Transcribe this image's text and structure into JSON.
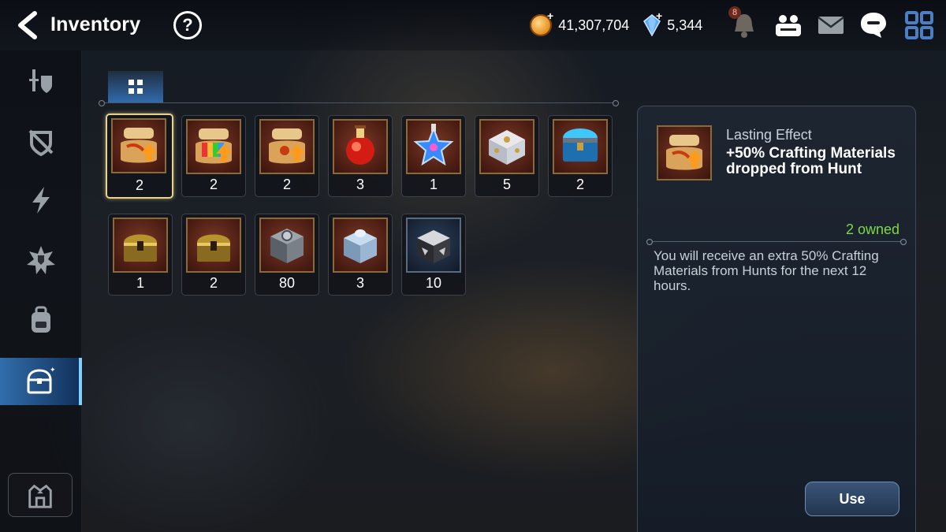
{
  "header": {
    "title": "Inventory",
    "help_label": "?",
    "gold": "41,307,704",
    "gems": "5,344",
    "plus_label": "+",
    "notification_count": "8",
    "icons": [
      "back-arrow-icon",
      "help-icon",
      "gold-coin-icon",
      "crystal-gem-icon",
      "bell-icon",
      "friends-icon",
      "mail-icon",
      "chat-icon",
      "grid-menu-icon"
    ]
  },
  "sidebar": {
    "items": [
      {
        "icon": "gear-equipment-icon"
      },
      {
        "icon": "shield-off-icon"
      },
      {
        "icon": "lightning-icon"
      },
      {
        "icon": "burst-shield-icon"
      },
      {
        "icon": "backpack-icon"
      },
      {
        "icon": "treasure-chest-icon",
        "active": true
      }
    ],
    "bottom_icon": "castle-home-icon"
  },
  "tabs": [
    {
      "icon": "grid-icon",
      "active": true
    }
  ],
  "items": [
    {
      "name": "scroll-crafting-boost",
      "count": "2",
      "selected": true
    },
    {
      "name": "scroll-rainbow-boost",
      "count": "2"
    },
    {
      "name": "scroll-boost",
      "count": "2"
    },
    {
      "name": "red-potion",
      "count": "3"
    },
    {
      "name": "star-potion",
      "count": "1"
    },
    {
      "name": "silver-chest",
      "count": "5"
    },
    {
      "name": "blue-chest",
      "count": "2"
    },
    {
      "name": "gold-chest",
      "count": "1"
    },
    {
      "name": "gold-chest-2",
      "count": "2"
    },
    {
      "name": "steel-box",
      "count": "80"
    },
    {
      "name": "ice-box",
      "count": "3"
    },
    {
      "name": "black-silver-box",
      "count": "10"
    }
  ],
  "detail": {
    "type": "Lasting Effect",
    "name": "+50% Crafting Materials dropped from Hunt",
    "owned": "2 owned",
    "description": "You will receive an extra 50% Crafting Materials from Hunts for the next 12 hours.",
    "use_label": "Use"
  },
  "colors": {
    "owned_green": "#7dd848",
    "selected_gold": "#e8d38a",
    "active_blue": "#3c8cdc"
  }
}
